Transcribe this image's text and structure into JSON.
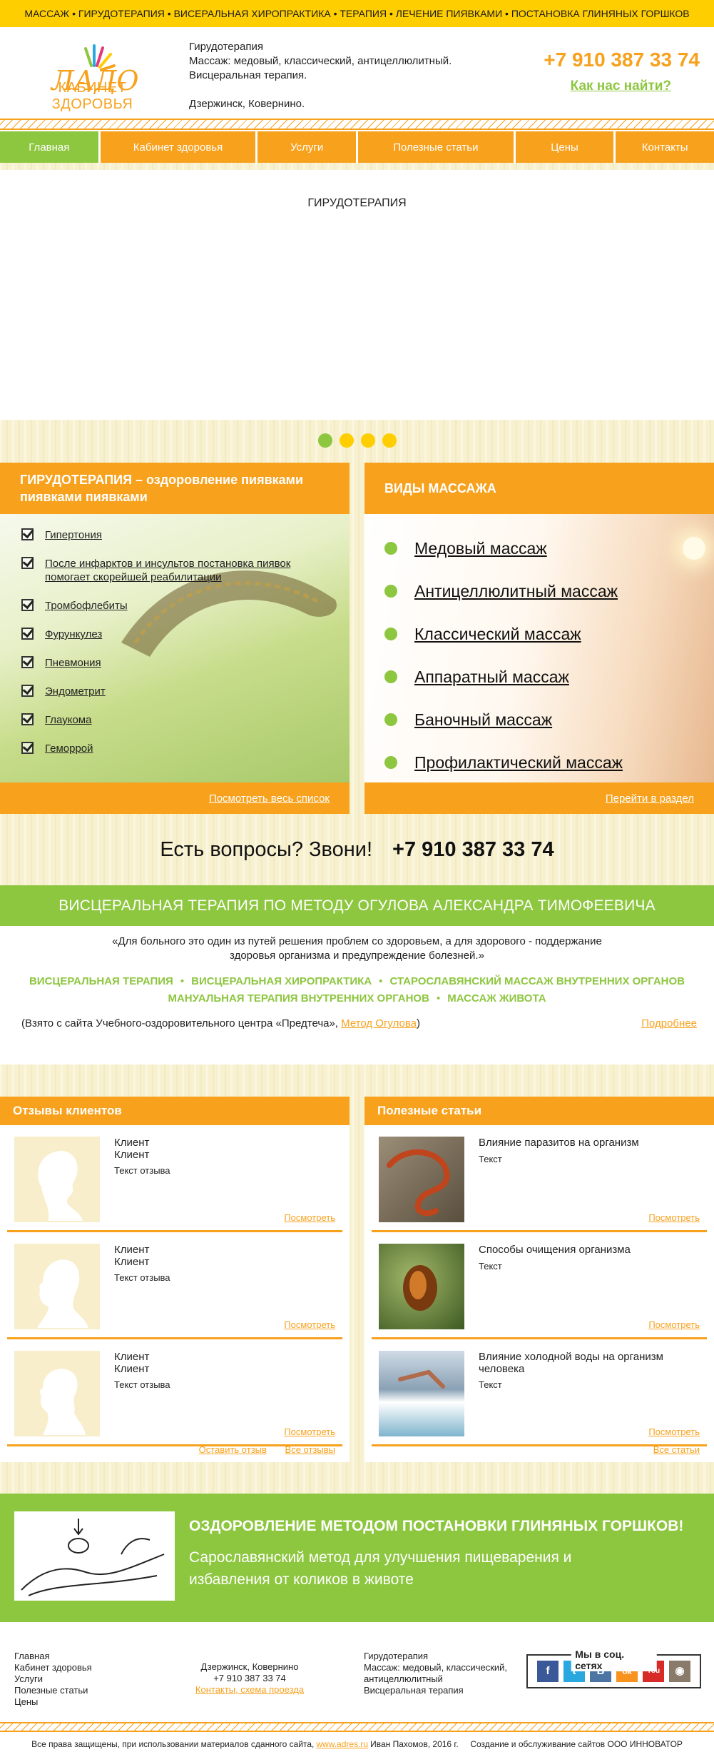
{
  "topbar": {
    "text": "МАССАЖ • ГИРУДОТЕРАПИЯ • ВИСЕРАЛЬНАЯ ХИРОПРАКТИКА • ТЕРАПИЯ • ЛЕЧЕНИЕ ПИЯВКАМИ • ПОСТАНОВКА ГЛИНЯНЫХ ГОРШКОВ"
  },
  "logo": {
    "script": "ЛАДО",
    "title": "КАБИНЕТ ЗДОРОВЬЯ"
  },
  "header": {
    "line1": "Гирудотерапия",
    "line2": "Массаж: медовый, классический, антицеллюлитный.",
    "line3": "Висцеральная терапия.",
    "address": "Дзержинск, Ковернино.",
    "phone": "+7 910 387 33 74",
    "find_us": "Как нас найти?"
  },
  "nav": [
    {
      "label": "Главная",
      "active": true
    },
    {
      "label": "Кабинет здоровья"
    },
    {
      "label": "Услуги"
    },
    {
      "label": "Полезные статьи"
    },
    {
      "label": "Цены"
    },
    {
      "label": "Контакты"
    }
  ],
  "slider": {
    "caption": "ГИРУДОТЕРАПИЯ",
    "active_dot": 1
  },
  "hirudo": {
    "heading": "ГИРУДОТЕРАПИЯ – оздоровление пиявками пиявками пиявками",
    "items": [
      "Гипертония",
      "После инфарктов и инсультов постановка пиявок помогает скорейшей реабилитации",
      "Тромбофлебиты",
      "Фурункулез",
      "Пневмония",
      "Эндометрит",
      "Глаукома",
      "Геморрой"
    ],
    "link": "Посмотреть весь список"
  },
  "massage": {
    "heading": "ВИДЫ МАССАЖА",
    "items": [
      "Медовый массаж",
      "Антицеллюлитный массаж",
      "Классический массаж",
      "Аппаратный массаж",
      "Баночный массаж",
      "Профилактический массаж"
    ],
    "link": "Перейти в раздел"
  },
  "call": {
    "text": "Есть вопросы? Звони!",
    "phone": "+7 910 387 33 74"
  },
  "visceral": {
    "heading": "ВИСЦЕРАЛЬНАЯ ТЕРАПИЯ ПО МЕТОДУ ОГУЛОВА АЛЕКСАНДРА ТИМОФЕЕВИЧА",
    "quote_line1": "«Для больного это один из путей решения проблем со здоровьем, а для здорового - поддержание",
    "quote_line2": "здоровья организма и предупреждение болезней.»",
    "tags_row1": [
      "ВИСЦЕРАЛЬНАЯ ТЕРАПИЯ",
      "ВИСЦЕРАЛЬНАЯ ХИРОПРАКТИКА",
      "СТАРОСЛАВЯНСКИЙ МАССАЖ ВНУТРЕННИХ ОРГАНОВ"
    ],
    "tags_row2": [
      "МАНУАЛЬНАЯ ТЕРАПИЯ ВНУТРЕННИХ ОРГАНОВ",
      "МАССАЖ ЖИВОТА"
    ],
    "source_prefix": "(Взято с сайта Учебного-оздоровительного центра «Предтеча»,",
    "source_link": "Метод Огулова",
    "source_suffix": ")",
    "more": "Подробнее"
  },
  "reviews": {
    "heading": "Отзывы клиентов",
    "items": [
      {
        "name1": "Клиент",
        "name2": "Клиент",
        "text": "Текст отзыва",
        "link": "Посмотреть",
        "avatar": "female-silhouette"
      },
      {
        "name1": "Клиент",
        "name2": "Клиент",
        "text": "Текст отзыва",
        "link": "Посмотреть",
        "avatar": "male-silhouette"
      },
      {
        "name1": "Клиент",
        "name2": "Клиент",
        "text": "Текст отзыва",
        "link": "Посмотреть",
        "avatar": "female-silhouette"
      }
    ],
    "leave": "Оставить отзыв",
    "all": "Все отзывы"
  },
  "articles": {
    "heading": "Полезные статьи",
    "items": [
      {
        "title": "Влияние паразитов на организм",
        "text": "Текст",
        "link": "Посмотреть"
      },
      {
        "title": "Способы очищения организма",
        "text": "Текст",
        "link": "Посмотреть"
      },
      {
        "title": "Влияние холодной воды на организм человека",
        "text": "Текст",
        "link": "Посмотреть"
      }
    ],
    "all": "Все статьи"
  },
  "promo": {
    "title": "ОЗДОРОВЛЕНИЕ МЕТОДОМ ПОСТАНОВКИ ГЛИНЯНЫХ ГОРШКОВ!",
    "subtitle": "Сарославянский метод для улучшения пищеварения и избавления от коликов в животе"
  },
  "footer": {
    "links": [
      "Главная",
      "Кабинет здоровья",
      "Услуги",
      "Полезные статьи",
      "Цены"
    ],
    "address": "Дзержинск, Ковернино",
    "phone": "+7 910 387 33 74",
    "contacts_link": "Контакты, схема проезда",
    "svc1": "Гирудотерапия",
    "svc2": "Массаж: медовый, классический,",
    "svc3": "антицеллюлитный",
    "svc4": "Висцеральная терапия",
    "social_label": "Мы в соц. сетях",
    "social": [
      {
        "icon": "facebook-icon",
        "glyph": "f",
        "color": "#3b5998"
      },
      {
        "icon": "twitter-icon",
        "glyph": "t",
        "color": "#29a8e0"
      },
      {
        "icon": "vk-icon",
        "glyph": "В",
        "color": "#4c75a3"
      },
      {
        "icon": "odnoklassniki-icon",
        "glyph": "ок",
        "color": "#f7931e"
      },
      {
        "icon": "youtube-icon",
        "glyph": "You",
        "color": "#d62b27"
      },
      {
        "icon": "instagram-icon",
        "glyph": "◉",
        "color": "#8a7a6a"
      }
    ],
    "copy_prefix": "Все права защищены, при использовании материалов сданного сайта,",
    "copy_link": "www.adres.ru",
    "copy_suffix": "Иван Пахомов, 2016 г.     Создание и обслуживание сайтов ООО ИННОВАТОР"
  },
  "colors": {
    "orange": "#f7a11d",
    "green": "#8dc63f",
    "yellow": "#ffce00"
  }
}
